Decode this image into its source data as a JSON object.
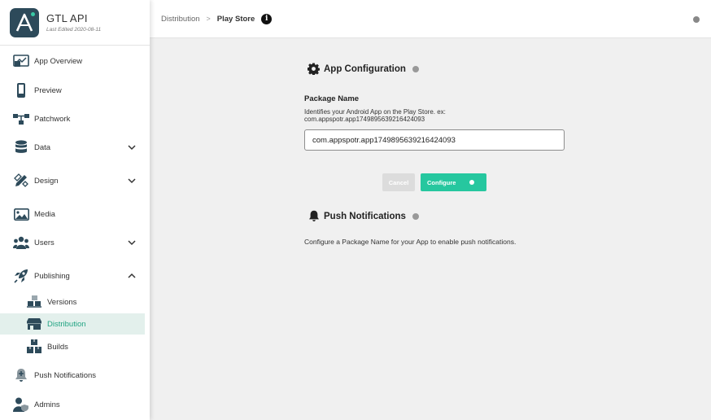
{
  "app": {
    "title": "GTL API",
    "last_edited": "Last Edited 2020-08-11"
  },
  "sidebar": {
    "items": [
      {
        "label": "App Overview",
        "icon": "app-overview-icon"
      },
      {
        "label": "Preview",
        "icon": "phone-icon"
      },
      {
        "label": "Patchwork",
        "icon": "patchwork-icon"
      },
      {
        "label": "Data",
        "icon": "database-icon",
        "expandable": true
      },
      {
        "label": "Design",
        "icon": "pencil-ruler-icon",
        "expandable": true
      },
      {
        "label": "Media",
        "icon": "image-icon"
      },
      {
        "label": "Users",
        "icon": "users-icon",
        "expandable": true
      },
      {
        "label": "Publishing",
        "icon": "rocket-icon",
        "expanded": true
      },
      {
        "label": "Versions",
        "icon": "versions-icon",
        "sub": true
      },
      {
        "label": "Distribution",
        "icon": "store-icon",
        "sub": true,
        "active": true
      },
      {
        "label": "Builds",
        "icon": "boxes-icon",
        "sub": true
      },
      {
        "label": "Push Notifications",
        "icon": "push-notification-icon"
      },
      {
        "label": "Admins",
        "icon": "admin-icon"
      }
    ]
  },
  "breadcrumb": {
    "parent": "Distribution",
    "separator": ">",
    "current": "Play Store",
    "info": "i"
  },
  "app_config": {
    "title": "App Configuration",
    "package_label": "Package Name",
    "package_help": "Identifies your Android App on the Play Store. ex: com.appspotr.app1749895639216424093",
    "package_value": "com.appspotr.app1749895639216424093",
    "cancel_label": "Cancel",
    "configure_label": "Configure"
  },
  "push": {
    "title": "Push Notifications",
    "text": "Configure a Package Name for your App to enable push notifications."
  },
  "colors": {
    "accent": "#26c79f",
    "active_bg": "#e3f0ec",
    "logo_bg": "#2d4a5a",
    "sidebar_icon": "#2d4a5a"
  }
}
